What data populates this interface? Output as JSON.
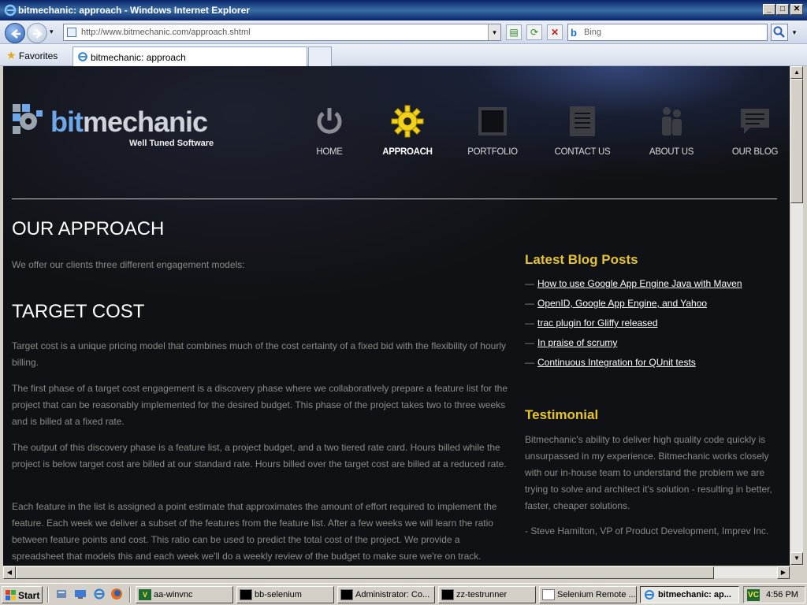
{
  "window": {
    "title": "bitmechanic: approach - Windows Internet Explorer",
    "min_label": "_",
    "max_label": "□",
    "close_label": "✕"
  },
  "navbar": {
    "url": "http://www.bitmechanic.com/approach.shtml",
    "search_placeholder": "Bing",
    "search_logo": "b",
    "dropdown_glyph": "▾"
  },
  "favbar": {
    "favorites_label": "Favorites",
    "tab_title": "bitmechanic: approach"
  },
  "site": {
    "logo": {
      "brand_bit": "bit",
      "brand_mechanic": "mechanic",
      "tagline": "Well Tuned Software"
    },
    "menu": [
      {
        "label": "HOME",
        "icon": "power-icon",
        "active": false
      },
      {
        "label": "APPROACH",
        "icon": "gear-icon",
        "active": true
      },
      {
        "label": "PORTFOLIO",
        "icon": "portfolio-frame-icon",
        "active": false
      },
      {
        "label": "CONTACT US",
        "icon": "document-icon",
        "active": false
      },
      {
        "label": "ABOUT US",
        "icon": "people-icon",
        "active": false
      },
      {
        "label": "OUR BLOG",
        "icon": "speech-bubble-icon",
        "active": false
      }
    ],
    "main": {
      "heading": "OUR APPROACH",
      "intro": "We offer our clients three different engagement models:",
      "section_heading": "TARGET COST",
      "paragraphs": [
        "Target cost is a unique pricing model that combines much of the cost certainty of a fixed bid with the flexibility of hourly billing.",
        "The first phase of a target cost engagement is a discovery phase where we collaboratively prepare a feature list for the project that can be reasonably implemented for the desired budget. This phase of the project takes two to three weeks and is billed at a fixed rate.",
        "The output of this discovery phase is a feature list, a project budget, and a two tiered rate card. Hours billed while the project is below target cost are billed at our standard rate. Hours billed over the target cost are billed at a reduced rate.",
        "Each feature in the list is assigned a point estimate that approximates the amount of effort required to implement the feature. Each week we deliver a subset of the features from the feature list. After a few weeks we will learn the ratio between feature points and cost. This ratio can be used to predict the total cost of the project. We provide a spreadsheet that models this and each week we'll do a weekly review of the budget to make sure we're on track."
      ]
    },
    "sidebar": {
      "blog_heading": "Latest Blog Posts",
      "dash": "—",
      "posts": [
        "How to use Google App Engine Java with Maven",
        "OpenID, Google App Engine, and Yahoo",
        "trac plugin for Gliffy released",
        "In praise of scrumy",
        "Continuous Integration for QUnit tests"
      ],
      "testimonial_heading": "Testimonial",
      "testimonial_text": "Bitmechanic's ability to deliver high quality code quickly is unsurpassed in my experience. Bitmechanic works closely with our in-house team to understand the problem we are trying to solve and architect it's solution - resulting in better, faster, cheaper solutions.",
      "testimonial_author": "- Steve Hamilton, VP of Product Development, Imprev Inc."
    }
  },
  "taskbar": {
    "start_label": "Start",
    "tasks": [
      {
        "label": "aa-winvnc",
        "icon": "vnc-icon",
        "active": false
      },
      {
        "label": "bb-selenium",
        "icon": "console-icon",
        "active": false
      },
      {
        "label": "Administrator: Co...",
        "icon": "console-icon",
        "active": false
      },
      {
        "label": "zz-testrunner",
        "icon": "console-icon",
        "active": false
      },
      {
        "label": "Selenium Remote ...",
        "icon": "document-icon",
        "active": false
      },
      {
        "label": "bitmechanic: ap...",
        "icon": "ie-icon",
        "active": true
      }
    ],
    "clock": "4:56 PM",
    "tray_icon": "VC"
  }
}
